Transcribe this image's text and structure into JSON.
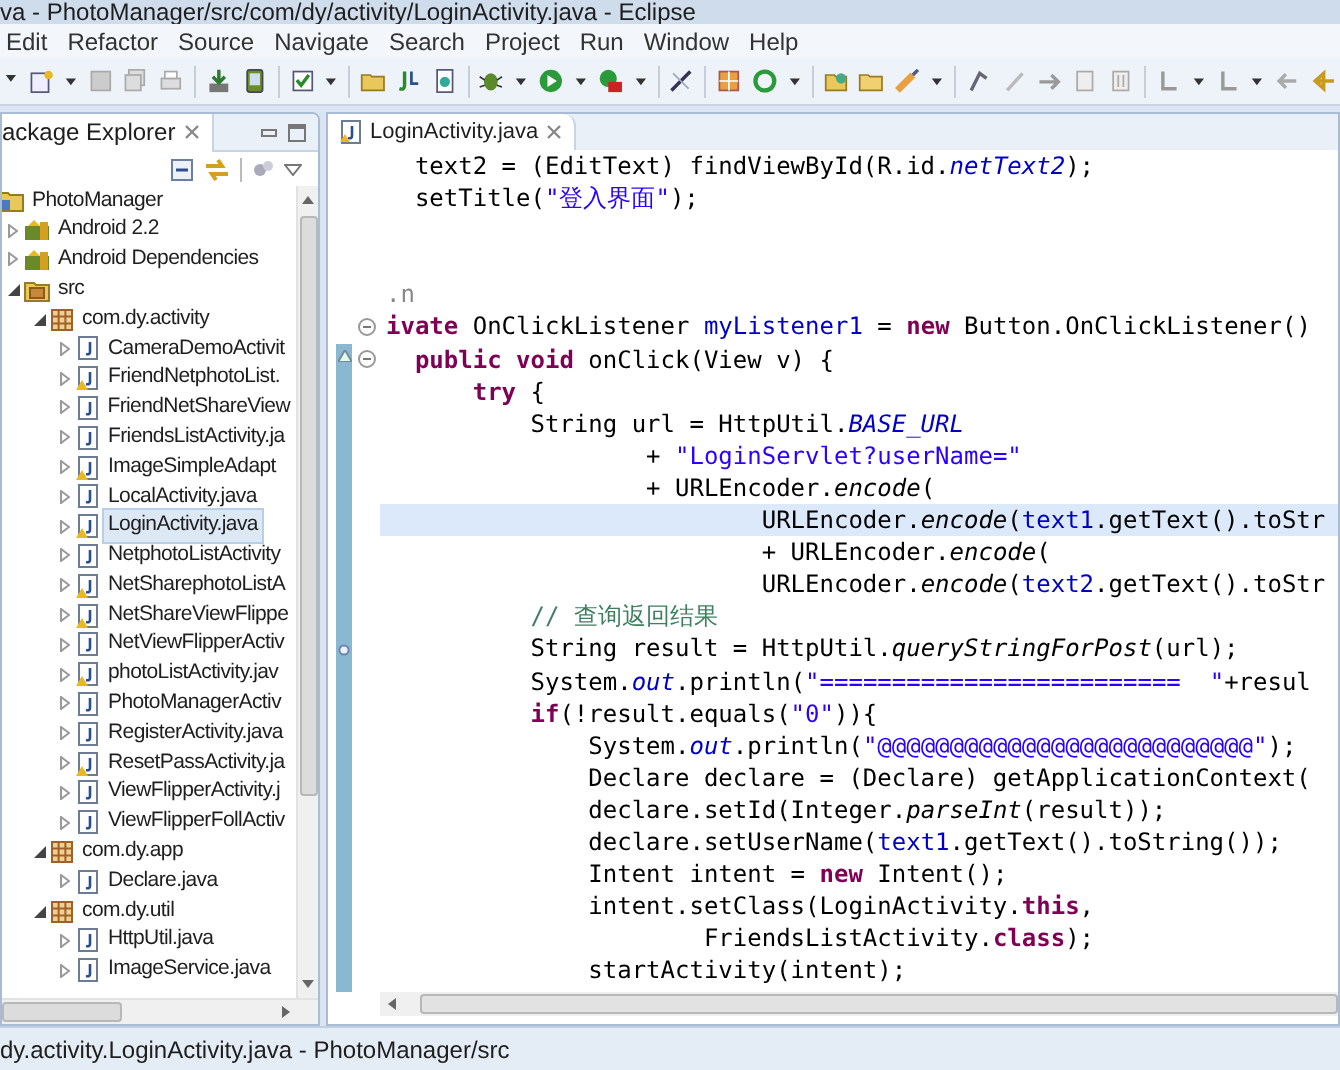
{
  "window": {
    "title": "va - PhotoManager/src/com/dy/activity/LoginActivity.java - Eclipse"
  },
  "menu": [
    "Edit",
    "Refactor",
    "Source",
    "Navigate",
    "Search",
    "Project",
    "Run",
    "Window",
    "Help"
  ],
  "package_explorer": {
    "title": "ackage Explorer",
    "tree": [
      {
        "label": "PhotoManager",
        "kind": "project",
        "expanded": true,
        "selected": false,
        "warning": false,
        "children": [
          {
            "label": "Android 2.2",
            "kind": "library",
            "expanded": false,
            "selected": false,
            "warning": false
          },
          {
            "label": "Android Dependencies",
            "kind": "library",
            "expanded": false,
            "selected": false,
            "warning": false
          },
          {
            "label": "src",
            "kind": "source-folder",
            "expanded": true,
            "selected": false,
            "warning": false,
            "children": [
              {
                "label": "com.dy.activity",
                "kind": "package",
                "expanded": true,
                "selected": false,
                "warning": false,
                "children": [
                  {
                    "label": "CameraDemoActivit",
                    "kind": "file",
                    "expanded": false,
                    "selected": false,
                    "warning": false
                  },
                  {
                    "label": "FriendNetphotoList.",
                    "kind": "file",
                    "expanded": false,
                    "selected": false,
                    "warning": true
                  },
                  {
                    "label": "FriendNetShareView",
                    "kind": "file",
                    "expanded": false,
                    "selected": false,
                    "warning": false
                  },
                  {
                    "label": "FriendsListActivity.ja",
                    "kind": "file",
                    "expanded": false,
                    "selected": false,
                    "warning": false
                  },
                  {
                    "label": "ImageSimpleAdapt",
                    "kind": "file",
                    "expanded": false,
                    "selected": false,
                    "warning": true
                  },
                  {
                    "label": "LocalActivity.java",
                    "kind": "file",
                    "expanded": false,
                    "selected": false,
                    "warning": false
                  },
                  {
                    "label": "LoginActivity.java",
                    "kind": "file",
                    "expanded": false,
                    "selected": true,
                    "warning": true
                  },
                  {
                    "label": "NetphotoListActivity",
                    "kind": "file",
                    "expanded": false,
                    "selected": false,
                    "warning": false
                  },
                  {
                    "label": "NetSharephotoListA",
                    "kind": "file",
                    "expanded": false,
                    "selected": false,
                    "warning": true
                  },
                  {
                    "label": "NetShareViewFlippe",
                    "kind": "file",
                    "expanded": false,
                    "selected": false,
                    "warning": true
                  },
                  {
                    "label": "NetViewFlipperActiv",
                    "kind": "file",
                    "expanded": false,
                    "selected": false,
                    "warning": false
                  },
                  {
                    "label": "photoListActivity.jav",
                    "kind": "file",
                    "expanded": false,
                    "selected": false,
                    "warning": true
                  },
                  {
                    "label": "PhotoManagerActiv",
                    "kind": "file",
                    "expanded": false,
                    "selected": false,
                    "warning": false
                  },
                  {
                    "label": "RegisterActivity.java",
                    "kind": "file",
                    "expanded": false,
                    "selected": false,
                    "warning": false
                  },
                  {
                    "label": "ResetPassActivity.ja",
                    "kind": "file",
                    "expanded": false,
                    "selected": false,
                    "warning": true
                  },
                  {
                    "label": "ViewFlipperActivity.j",
                    "kind": "file",
                    "expanded": false,
                    "selected": false,
                    "warning": false
                  },
                  {
                    "label": "ViewFlipperFollActiv",
                    "kind": "file",
                    "expanded": false,
                    "selected": false,
                    "warning": false
                  }
                ]
              },
              {
                "label": "com.dy.app",
                "kind": "package",
                "expanded": true,
                "selected": false,
                "warning": false,
                "children": [
                  {
                    "label": "Declare.java",
                    "kind": "file",
                    "expanded": false,
                    "selected": false,
                    "warning": false
                  }
                ]
              },
              {
                "label": "com.dy.util",
                "kind": "package",
                "expanded": true,
                "selected": false,
                "warning": false,
                "children": [
                  {
                    "label": "HttpUtil.java",
                    "kind": "file",
                    "expanded": false,
                    "selected": false,
                    "warning": false
                  },
                  {
                    "label": "ImageService.java",
                    "kind": "file",
                    "expanded": false,
                    "selected": false,
                    "warning": false
                  }
                ]
              }
            ]
          }
        ]
      }
    ]
  },
  "editor": {
    "tab": "LoginActivity.java",
    "fragment": [
      {
        "current": false,
        "fold": false,
        "segments": [
          {
            "text": "  text2 = (EditText) findViewById(R.id.",
            "kind": "plain"
          },
          {
            "text": "netText2",
            "kind": "field"
          },
          {
            "text": ");",
            "kind": "plain"
          }
        ]
      },
      {
        "current": false,
        "fold": false,
        "segments": [
          {
            "text": "  setTitle(",
            "kind": "plain"
          },
          {
            "text": "\"登入界面\"",
            "kind": "string"
          },
          {
            "text": ");",
            "kind": "plain"
          }
        ]
      }
    ],
    "lines": [
      {
        "current": false,
        "fold": false,
        "segments": [
          {
            "text": ".n",
            "kind": "dim"
          }
        ]
      },
      {
        "current": false,
        "fold": true,
        "segments": [
          {
            "text": "ivate",
            "kind": "keyword"
          },
          {
            "text": " OnClickListener ",
            "kind": "plain"
          },
          {
            "text": "myListener1",
            "kind": "variable"
          },
          {
            "text": " = ",
            "kind": "plain"
          },
          {
            "text": "new",
            "kind": "keyword"
          },
          {
            "text": " Button.OnClickListener()",
            "kind": "plain"
          }
        ]
      },
      {
        "current": false,
        "fold": true,
        "segments": [
          {
            "text": "  public void",
            "kind": "keyword"
          },
          {
            "text": " onClick(View v) {",
            "kind": "plain"
          }
        ]
      },
      {
        "current": false,
        "fold": false,
        "segments": [
          {
            "text": "      try",
            "kind": "keyword"
          },
          {
            "text": " {",
            "kind": "plain"
          }
        ]
      },
      {
        "current": false,
        "fold": false,
        "segments": [
          {
            "text": "          String url = HttpUtil.",
            "kind": "plain"
          },
          {
            "text": "BASE_URL",
            "kind": "field"
          }
        ]
      },
      {
        "current": false,
        "fold": false,
        "segments": [
          {
            "text": "                  + ",
            "kind": "plain"
          },
          {
            "text": "\"LoginServlet?userName=\"",
            "kind": "string"
          }
        ]
      },
      {
        "current": false,
        "fold": false,
        "segments": [
          {
            "text": "                  + URLEncoder.",
            "kind": "plain"
          },
          {
            "text": "encode",
            "kind": "static"
          },
          {
            "text": "(",
            "kind": "plain"
          }
        ]
      },
      {
        "current": true,
        "fold": false,
        "segments": [
          {
            "text": "                          URLEncoder.",
            "kind": "plain"
          },
          {
            "text": "encode",
            "kind": "static"
          },
          {
            "text": "(",
            "kind": "plain"
          },
          {
            "text": "text1",
            "kind": "variable"
          },
          {
            "text": ".getText().toStr",
            "kind": "plain"
          }
        ]
      },
      {
        "current": false,
        "fold": false,
        "segments": [
          {
            "text": "                          + URLEncoder.",
            "kind": "plain"
          },
          {
            "text": "encode",
            "kind": "static"
          },
          {
            "text": "(",
            "kind": "plain"
          }
        ]
      },
      {
        "current": false,
        "fold": false,
        "segments": [
          {
            "text": "                          URLEncoder.",
            "kind": "plain"
          },
          {
            "text": "encode",
            "kind": "static"
          },
          {
            "text": "(",
            "kind": "plain"
          },
          {
            "text": "text2",
            "kind": "variable"
          },
          {
            "text": ".getText().toStr",
            "kind": "plain"
          }
        ]
      },
      {
        "current": false,
        "fold": false,
        "segments": [
          {
            "text": "          // 查询返回结果",
            "kind": "comment"
          }
        ]
      },
      {
        "current": false,
        "fold": false,
        "segments": [
          {
            "text": "          String result = HttpUtil.",
            "kind": "plain"
          },
          {
            "text": "queryStringForPost",
            "kind": "static"
          },
          {
            "text": "(url);",
            "kind": "plain"
          }
        ]
      },
      {
        "current": false,
        "fold": false,
        "segments": [
          {
            "text": "          System.",
            "kind": "plain"
          },
          {
            "text": "out",
            "kind": "field"
          },
          {
            "text": ".println(",
            "kind": "plain"
          },
          {
            "text": "\"=========================  \"",
            "kind": "string"
          },
          {
            "text": "+resul",
            "kind": "plain"
          }
        ]
      },
      {
        "current": false,
        "fold": false,
        "segments": [
          {
            "text": "          if",
            "kind": "keyword"
          },
          {
            "text": "(!result.equals(",
            "kind": "plain"
          },
          {
            "text": "\"0\"",
            "kind": "string"
          },
          {
            "text": ")){",
            "kind": "plain"
          }
        ]
      },
      {
        "current": false,
        "fold": false,
        "segments": [
          {
            "text": "              System.",
            "kind": "plain"
          },
          {
            "text": "out",
            "kind": "field"
          },
          {
            "text": ".println(",
            "kind": "plain"
          },
          {
            "text": "\"@@@@@@@@@@@@@@@@@@@@@@@@@@\"",
            "kind": "string"
          },
          {
            "text": ");",
            "kind": "plain"
          }
        ]
      },
      {
        "current": false,
        "fold": false,
        "segments": [
          {
            "text": "              Declare declare = (Declare) getApplicationContext(",
            "kind": "plain"
          }
        ]
      },
      {
        "current": false,
        "fold": false,
        "segments": [
          {
            "text": "              declare.setId(Integer.",
            "kind": "plain"
          },
          {
            "text": "parseInt",
            "kind": "static"
          },
          {
            "text": "(result));",
            "kind": "plain"
          }
        ]
      },
      {
        "current": false,
        "fold": false,
        "segments": [
          {
            "text": "              declare.setUserName(",
            "kind": "plain"
          },
          {
            "text": "text1",
            "kind": "variable"
          },
          {
            "text": ".getText().toString());",
            "kind": "plain"
          }
        ]
      },
      {
        "current": false,
        "fold": false,
        "segments": [
          {
            "text": "              Intent intent = ",
            "kind": "plain"
          },
          {
            "text": "new",
            "kind": "keyword"
          },
          {
            "text": " Intent();",
            "kind": "plain"
          }
        ]
      },
      {
        "current": false,
        "fold": false,
        "segments": [
          {
            "text": "              intent.setClass(LoginActivity.",
            "kind": "plain"
          },
          {
            "text": "this",
            "kind": "keyword"
          },
          {
            "text": ",",
            "kind": "plain"
          }
        ]
      },
      {
        "current": false,
        "fold": false,
        "segments": [
          {
            "text": "                      FriendsListActivity.",
            "kind": "plain"
          },
          {
            "text": "class",
            "kind": "keyword"
          },
          {
            "text": ");",
            "kind": "plain"
          }
        ]
      },
      {
        "current": false,
        "fold": false,
        "segments": [
          {
            "text": "              startActivity(intent);",
            "kind": "plain"
          }
        ]
      }
    ]
  },
  "status_bar": "dy.activity.LoginActivity.java - PhotoManager/src"
}
